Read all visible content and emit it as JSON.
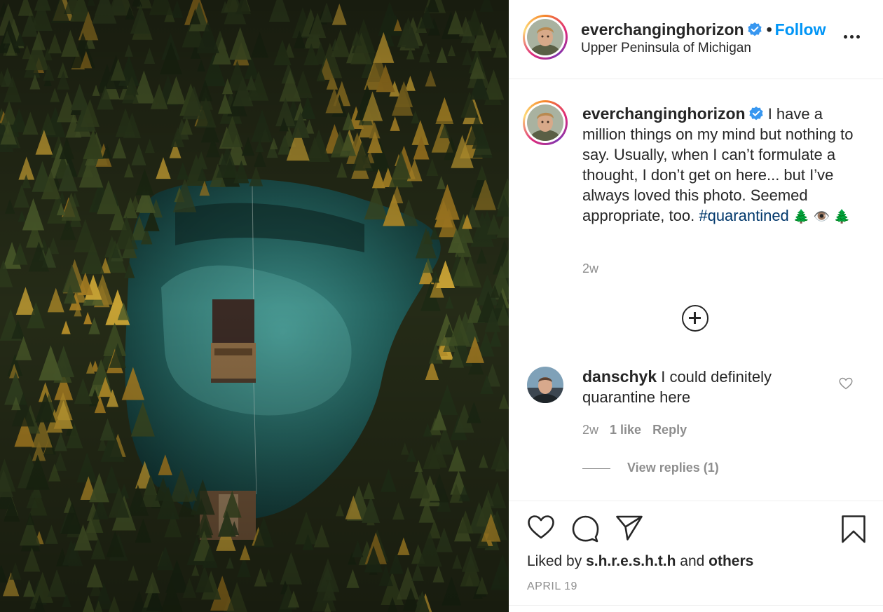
{
  "post": {
    "username": "everchanginghorizon",
    "separator": "•",
    "follow_label": "Follow",
    "location": "Upper Peninsula of Michigan"
  },
  "caption": {
    "username": "everchanginghorizon",
    "text": " I have a million things on my mind but nothing to say. Usually, when I can’t formulate a thought, I don’t get on here... but I’ve always loved this photo. Seemed appropriate, too. ",
    "hashtag": "#quarantined",
    "emojis": "🌲 👁️ 🌲",
    "time": "2w"
  },
  "comment": {
    "username": "danschyk",
    "text": " I could definitely quarantine here",
    "time": "2w",
    "likes": "1 like",
    "reply_label": "Reply",
    "view_replies": "View replies (1)"
  },
  "footer": {
    "liked_prefix": "Liked by ",
    "liked_user": "s.h.r.e.s.h.t.h",
    "liked_and": " and ",
    "liked_others": "others",
    "date": "APRIL 19"
  },
  "colors": {
    "accent": "#0095f6",
    "hashtag": "#00376b",
    "secondary_text": "#8e8e8e",
    "primary_text": "#262626"
  },
  "icons": {
    "verified": "verified-badge-icon",
    "more": "more-options-icon",
    "add": "plus-circle-icon",
    "comment_like": "heart-outline-icon",
    "like": "heart-icon",
    "comment": "comment-bubble-icon",
    "share": "paper-plane-icon",
    "save": "bookmark-icon"
  }
}
